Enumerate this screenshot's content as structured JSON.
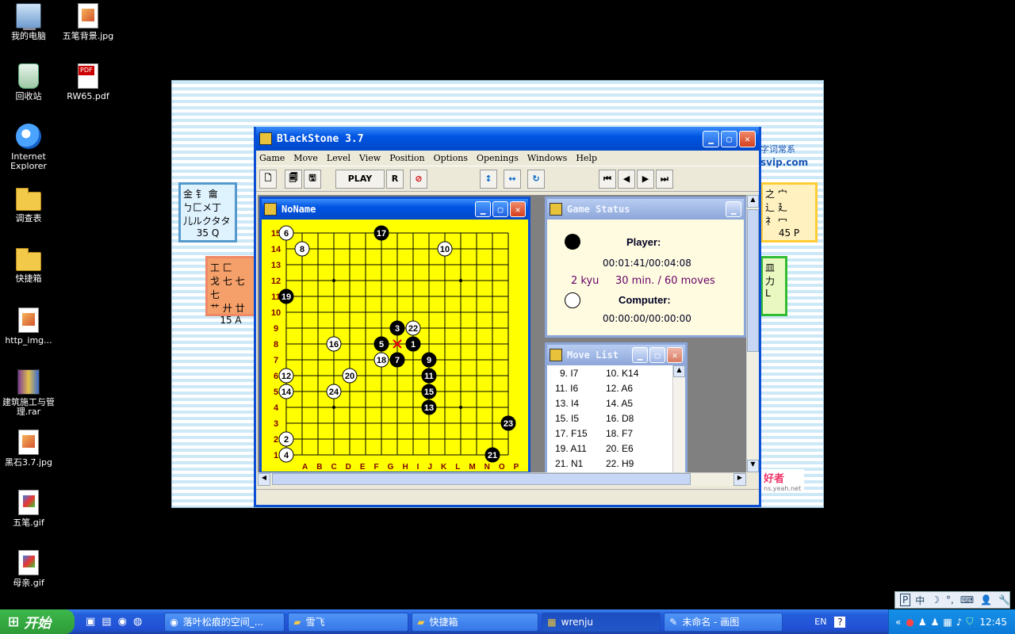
{
  "desktop_icons": [
    {
      "label": "我的电脑",
      "icon": "computer-icon"
    },
    {
      "label": "五笔背景.jpg",
      "icon": "jpg-file-icon"
    },
    {
      "label": "回收站",
      "icon": "recycle-bin-icon"
    },
    {
      "label": "RW65.pdf",
      "icon": "pdf-file-icon"
    },
    {
      "label": "Internet Explorer",
      "icon": "ie-icon"
    },
    {
      "label": "调查表",
      "icon": "folder-icon"
    },
    {
      "label": "快捷箱",
      "icon": "folder-icon"
    },
    {
      "label": "http_img...",
      "icon": "jpg-file-icon"
    },
    {
      "label": "建筑施工与管理.rar",
      "icon": "rar-file-icon"
    },
    {
      "label": "黑石3.7.jpg",
      "icon": "jpg-file-icon"
    },
    {
      "label": "五笔.gif",
      "icon": "gif-file-icon"
    },
    {
      "label": "母亲.gif",
      "icon": "gif-file-icon"
    }
  ],
  "wallpaper": {
    "card1": {
      "line1": "金 钅 龠",
      "line2": "ㄅ匚メ丁",
      "line3": "儿ルクタタ",
      "code": "35 Q"
    },
    "card2": {
      "line1": "工 匚",
      "line2": "戈 七 七 七",
      "line3": "艹 廾 廿",
      "code": "15 A"
    },
    "card3": {
      "line1": "之 宀",
      "line2": "辶 廴",
      "line3": "礻 冖",
      "code": "45 P"
    },
    "card4": {
      "line1": "皿",
      "line2": "力",
      "line3": "L",
      "code": ""
    },
    "text_right": "字词常系",
    "url_right": "svip.com",
    "bottom_right": "好者",
    "bottom_url": "ns.yeah.net"
  },
  "window": {
    "title": "BlackStone 3.7",
    "menu": [
      "Game",
      "Move",
      "Level",
      "View",
      "Position",
      "Options",
      "Openings",
      "Windows",
      "Help"
    ],
    "toolbar": {
      "play": "PLAY",
      "r": "R"
    }
  },
  "board_window": {
    "title": "NoName"
  },
  "board": {
    "size": 15,
    "cols": [
      "A",
      "B",
      "C",
      "D",
      "E",
      "F",
      "G",
      "H",
      "I",
      "J",
      "K",
      "L",
      "M",
      "N",
      "O"
    ],
    "footer_cols": "A B C D E F G H I J K L M N O P",
    "last_move": "H8",
    "stones": [
      {
        "n": 1,
        "col": "I",
        "row": 8,
        "color": "black"
      },
      {
        "n": 2,
        "col": "A",
        "row": 2,
        "color": "white"
      },
      {
        "n": 3,
        "col": "H",
        "row": 9,
        "color": "black"
      },
      {
        "n": 4,
        "col": "A",
        "row": 1,
        "color": "white"
      },
      {
        "n": 5,
        "col": "G",
        "row": 8,
        "color": "black"
      },
      {
        "n": 6,
        "col": "A",
        "row": 15,
        "color": "white"
      },
      {
        "n": 7,
        "col": "H",
        "row": 7,
        "color": "black"
      },
      {
        "n": 8,
        "col": "B",
        "row": 14,
        "color": "white"
      },
      {
        "n": 9,
        "col": "J",
        "row": 7,
        "color": "black"
      },
      {
        "n": 10,
        "col": "K",
        "row": 14,
        "color": "white"
      },
      {
        "n": 11,
        "col": "J",
        "row": 6,
        "color": "black"
      },
      {
        "n": 12,
        "col": "A",
        "row": 6,
        "color": "white"
      },
      {
        "n": 13,
        "col": "J",
        "row": 4,
        "color": "black"
      },
      {
        "n": 14,
        "col": "A",
        "row": 5,
        "color": "white"
      },
      {
        "n": 15,
        "col": "J",
        "row": 5,
        "color": "black"
      },
      {
        "n": 16,
        "col": "D",
        "row": 8,
        "color": "white"
      },
      {
        "n": 17,
        "col": "G",
        "row": 15,
        "color": "black"
      },
      {
        "n": 18,
        "col": "G",
        "row": 7,
        "color": "white"
      },
      {
        "n": 19,
        "col": "A",
        "row": 11,
        "color": "black"
      },
      {
        "n": 20,
        "col": "E",
        "row": 6,
        "color": "white"
      },
      {
        "n": 21,
        "col": "N",
        "row": 1,
        "color": "black"
      },
      {
        "n": 22,
        "col": "I",
        "row": 9,
        "color": "white"
      },
      {
        "n": 23,
        "col": "O",
        "row": 3,
        "color": "black"
      },
      {
        "n": 24,
        "col": "D",
        "row": 5,
        "color": "white"
      }
    ]
  },
  "status_window": {
    "title": "Game Status",
    "player_label": "Player:",
    "player_time": "00:01:41/00:04:08",
    "level": "2 kyu",
    "time_control": "30 min. / 60 moves",
    "computer_label": "Computer:",
    "computer_time": "00:00:00/00:00:00"
  },
  "move_window": {
    "title": "Move List",
    "rows": [
      [
        "9. I7",
        "10. K14"
      ],
      [
        "11. I6",
        "12. A6"
      ],
      [
        "13. I4",
        "14. A5"
      ],
      [
        "15. I5",
        "16. D8"
      ],
      [
        "17. F15",
        "18. F7"
      ],
      [
        "19. A11",
        "20. E6"
      ],
      [
        "21. N1",
        "22. H9"
      ]
    ]
  },
  "taskbar": {
    "start": "开始",
    "tasks": [
      "落叶松痕的空间_...",
      "雪飞",
      "快捷箱",
      "wrenju",
      "未命名 - 画图"
    ],
    "lang": "EN",
    "clock": "12:45",
    "ime": "中"
  }
}
